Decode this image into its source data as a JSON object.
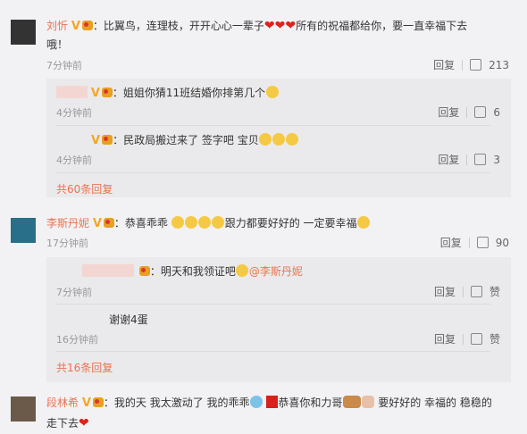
{
  "comments": [
    {
      "name": "刘忻",
      "text1": "：比翼鸟，连理枝，开开心心一辈子",
      "text2": "所有的祝福都给你，要一直幸福下去",
      "text3": "哦！",
      "time": "7分钟前",
      "reply": "回复",
      "likes": "213",
      "replies": [
        {
          "text": "：姐姐你猜11班结婚你排第几个",
          "time": "4分钟前",
          "reply": "回复",
          "likes": "6"
        },
        {
          "text": "：民政局搬过来了 签字吧 宝贝",
          "time": "4分钟前",
          "reply": "回复",
          "likes": "3"
        }
      ],
      "more": "共60条回复"
    },
    {
      "name": "李斯丹妮",
      "text1": "：恭喜乖乖 ",
      "text2": "跟力都要好好的 一定要幸福",
      "time": "17分钟前",
      "reply": "回复",
      "likes": "90",
      "replies": [
        {
          "text": "：明天和我领证吧",
          "mention": "@李斯丹妮",
          "time": "7分钟前",
          "reply": "回复",
          "likes": "赞"
        },
        {
          "text": "谢谢4蛋",
          "time": "16分钟前",
          "reply": "回复",
          "likes": "赞"
        }
      ],
      "more": "共16条回复"
    },
    {
      "name": "段林希",
      "text1": "：我的天 我太激动了 我的乖乖",
      "text2": "恭喜你和力哥",
      "text3": " 要好好的 幸福的 稳稳的",
      "text4": "走下去"
    }
  ]
}
